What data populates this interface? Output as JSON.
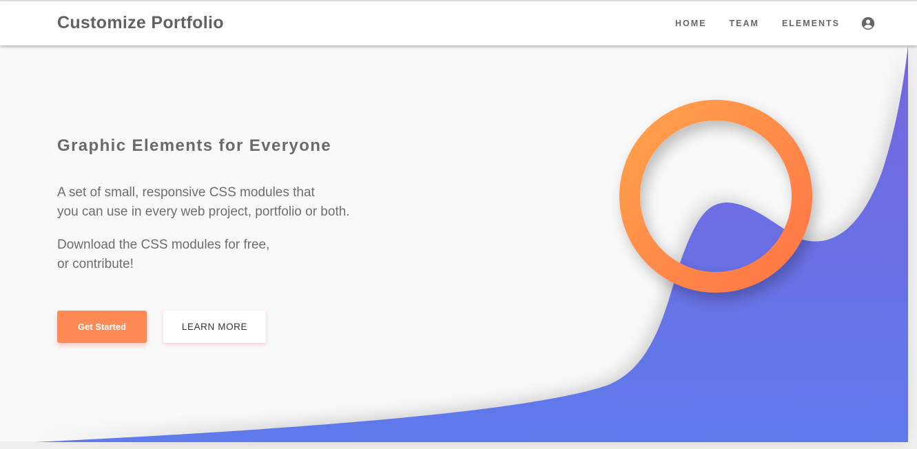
{
  "navbar": {
    "brand": "Customize Portfolio",
    "links": [
      "HOME",
      "TEAM",
      "ELEMENTS"
    ],
    "user_icon": "account-circle-icon"
  },
  "hero": {
    "title": "Graphic Elements for Everyone",
    "paragraph1_line1": "A set of small, responsive CSS modules that",
    "paragraph1_line2": "you can use in every web project, portfolio or both.",
    "paragraph2_line1": "Download the CSS modules for free,",
    "paragraph2_line2": "or contribute!"
  },
  "buttons": {
    "primary_label": "Get Started",
    "secondary_label": "LEARN MORE"
  },
  "colors": {
    "accent_orange": "#ff8a54",
    "wave_purple": "#7165dc",
    "wave_blue": "#5f7bec",
    "ring_orange_start": "#ff9a4a",
    "ring_orange_end": "#ff7a45"
  }
}
